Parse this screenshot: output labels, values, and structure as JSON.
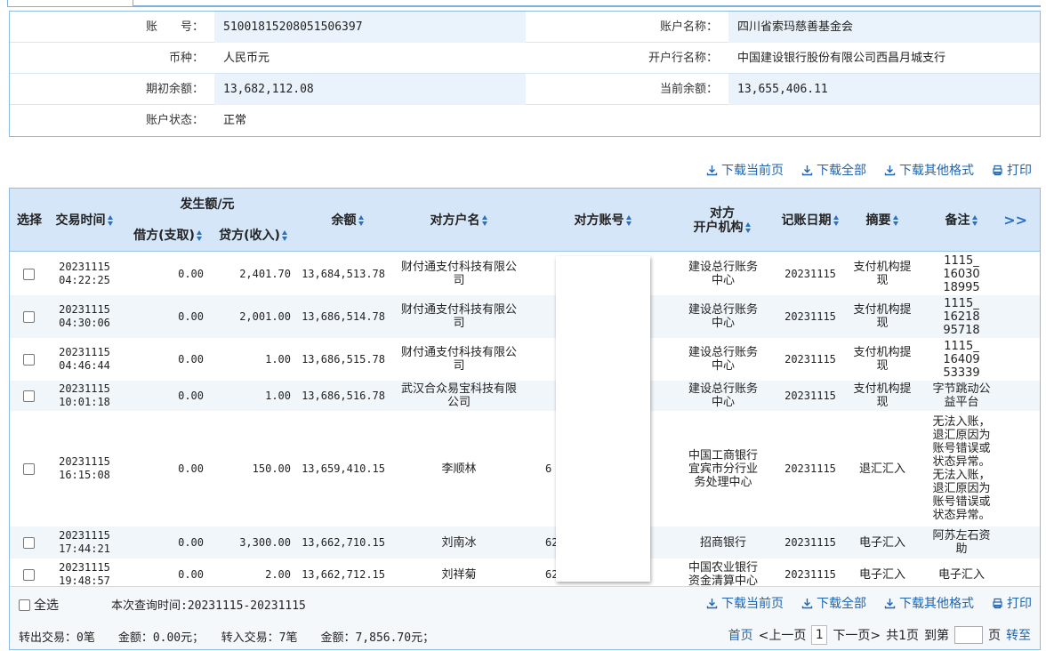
{
  "account": {
    "number_label": "账　　号：",
    "number": "51001815208051506397",
    "name_label": "账户名称：",
    "name": "四川省索玛慈善基金会",
    "currency_label": "币种：",
    "currency": "人民币元",
    "bank_label": "开户行名称：",
    "bank": "中国建设银行股份有限公司西昌月城支行",
    "opening_label": "期初余额：",
    "opening": "13,682,112.08",
    "current_label": "当前余额：",
    "current": "13,655,406.11",
    "status_label": "账户状态：",
    "status": "正常"
  },
  "toolbar": {
    "download_page": "下载当前页",
    "download_all": "下载全部",
    "download_other": "下载其他格式",
    "print": "打印"
  },
  "headers": {
    "select": "选择",
    "time": "交易时间",
    "amount_group": "发生额/元",
    "debit": "借方(支取)",
    "credit": "贷方(收入)",
    "balance": "余额",
    "party_name": "对方户名",
    "party_account": "对方账号",
    "party_bank_1": "对方",
    "party_bank_2": "开户机构",
    "post_date": "记账日期",
    "summary": "摘要",
    "remark": "备注",
    "more": ">>"
  },
  "rows": [
    {
      "date": "20231115",
      "time": "04:22:25",
      "debit": "0.00",
      "credit": "2,401.70",
      "balance": "13,684,513.78",
      "name_1": "财付通支付科技有限公",
      "name_2": "司",
      "acct": "",
      "bank_1": "建设总行账务",
      "bank_2": "中心",
      "bank_3": "",
      "post": "20231115",
      "sum_1": "支付机构提",
      "sum_2": "现",
      "rem": [
        "1115_",
        "16030",
        "18995"
      ]
    },
    {
      "date": "20231115",
      "time": "04:30:06",
      "debit": "0.00",
      "credit": "2,001.00",
      "balance": "13,686,514.78",
      "name_1": "财付通支付科技有限公",
      "name_2": "司",
      "acct": "",
      "bank_1": "建设总行账务",
      "bank_2": "中心",
      "bank_3": "",
      "post": "20231115",
      "sum_1": "支付机构提",
      "sum_2": "现",
      "rem": [
        "1115_",
        "16218",
        "95718"
      ]
    },
    {
      "date": "20231115",
      "time": "04:46:44",
      "debit": "0.00",
      "credit": "1.00",
      "balance": "13,686,515.78",
      "name_1": "财付通支付科技有限公",
      "name_2": "司",
      "acct": "",
      "bank_1": "建设总行账务",
      "bank_2": "中心",
      "bank_3": "",
      "post": "20231115",
      "sum_1": "支付机构提",
      "sum_2": "现",
      "rem": [
        "1115_",
        "16409",
        "53339"
      ]
    },
    {
      "date": "20231115",
      "time": "10:01:18",
      "debit": "0.00",
      "credit": "1.00",
      "balance": "13,686,516.78",
      "name_1": "武汉合众易宝科技有限",
      "name_2": "公司",
      "acct": "",
      "bank_1": "建设总行账务",
      "bank_2": "中心",
      "bank_3": "",
      "post": "20231115",
      "sum_1": "支付机构提",
      "sum_2": "现",
      "rem": [
        "字节跳动公",
        "益平台"
      ]
    },
    {
      "date": "20231115",
      "time": "16:15:08",
      "debit": "0.00",
      "credit": "150.00",
      "balance": "13,659,410.15",
      "name_1": "李顺林",
      "name_2": "",
      "acct": "6",
      "bank_1": "中国工商银行",
      "bank_2": "宜宾市分行业",
      "bank_3": "务处理中心",
      "post": "20231115",
      "sum_1": "退汇汇入",
      "sum_2": "",
      "rem": [
        "无法入账，",
        "退汇原因为",
        "账号错误或",
        "状态异常。",
        "无法入账，",
        "退汇原因为",
        "账号错误或",
        "状态异常。"
      ]
    },
    {
      "date": "20231115",
      "time": "17:44:21",
      "debit": "0.00",
      "credit": "3,300.00",
      "balance": "13,662,710.15",
      "name_1": "刘南冰",
      "name_2": "",
      "acct": "62",
      "bank_1": "招商银行",
      "bank_2": "",
      "bank_3": "",
      "post": "20231115",
      "sum_1": "电子汇入",
      "sum_2": "",
      "rem": [
        "阿苏左石资",
        "助"
      ]
    },
    {
      "date": "20231115",
      "time": "19:48:57",
      "debit": "0.00",
      "credit": "2.00",
      "balance": "13,662,712.15",
      "name_1": "刘祥菊",
      "name_2": "",
      "acct": "622",
      "bank_1": "中国农业银行",
      "bank_2": "资金清算中心",
      "bank_3": "",
      "post": "20231115",
      "sum_1": "电子汇入",
      "sum_2": "",
      "rem": [
        "电子汇入"
      ]
    }
  ],
  "footer": {
    "select_all": "全选",
    "period": "本次查询时间:20231115-20231115",
    "summary": "转出交易：0笔　　金额：0.00元；　　转入交易：7笔　　金额：7,856.70元；",
    "first": "首页",
    "prev": "<上一页",
    "current_page": "1",
    "next": "下一页>",
    "total": "共1页",
    "goto": "到第",
    "page_unit": "页",
    "go": "转至"
  },
  "colors": {
    "accent": "#1f64b0",
    "header_bg": "#d4e6f7",
    "border": "#8fbbe0"
  }
}
